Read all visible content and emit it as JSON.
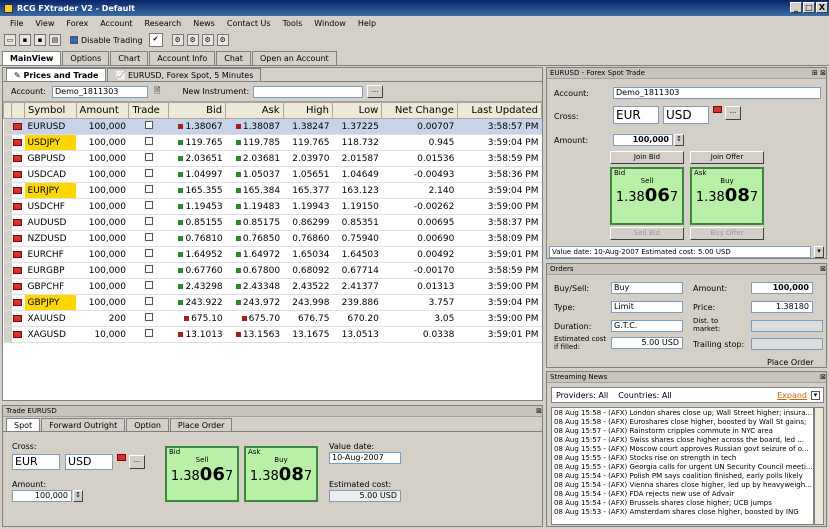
{
  "window": {
    "title": "RCG FXtrader V2 - Default",
    "min": "_",
    "max": "□",
    "close": "X"
  },
  "menu": [
    "File",
    "View",
    "Forex",
    "Account",
    "Research",
    "News",
    "Contact Us",
    "Tools",
    "Window",
    "Help"
  ],
  "toolbar": {
    "disable_trading": "Disable Trading"
  },
  "main_tabs": [
    "MainView",
    "Options",
    "Chart",
    "Account Info",
    "Chat",
    "Open an Account"
  ],
  "doc_tabs": [
    "Prices and Trade",
    "EURUSD, Forex Spot, 5 Minutes"
  ],
  "account_bar": {
    "account_label": "Account:",
    "account_value": "Demo_1811303",
    "new_instrument_label": "New Instrument:",
    "browse": "..."
  },
  "columns": [
    "Symbol",
    "Amount",
    "Trade",
    "Bid",
    "Ask",
    "High",
    "Low",
    "Net Change",
    "Last Updated"
  ],
  "rows": [
    {
      "symbol": "EURUSD",
      "amount": "100,000",
      "bid": "1.38067",
      "ask": "1.38087",
      "high": "1.38247",
      "low": "1.37225",
      "change": "0.00707",
      "updated": "3:58:57 PM",
      "hl": false,
      "dir": "dn"
    },
    {
      "symbol": "USDJPY",
      "amount": "100,000",
      "bid": "119.765",
      "ask": "119.785",
      "high": "119.765",
      "low": "118.732",
      "change": "0.945",
      "updated": "3:59:04 PM",
      "hl": true,
      "dir": "up"
    },
    {
      "symbol": "GBPUSD",
      "amount": "100,000",
      "bid": "2.03651",
      "ask": "2.03681",
      "high": "2.03970",
      "low": "2.01587",
      "change": "0.01536",
      "updated": "3:58:59 PM",
      "hl": false,
      "dir": "up"
    },
    {
      "symbol": "USDCAD",
      "amount": "100,000",
      "bid": "1.04997",
      "ask": "1.05037",
      "high": "1.05651",
      "low": "1.04649",
      "change": "-0.00493",
      "updated": "3:58:36 PM",
      "hl": false,
      "dir": "up"
    },
    {
      "symbol": "EURJPY",
      "amount": "100,000",
      "bid": "165.355",
      "ask": "165.384",
      "high": "165.377",
      "low": "163.123",
      "change": "2.140",
      "updated": "3:59:04 PM",
      "hl": true,
      "dir": "up"
    },
    {
      "symbol": "USDCHF",
      "amount": "100,000",
      "bid": "1.19453",
      "ask": "1.19483",
      "high": "1.19943",
      "low": "1.19150",
      "change": "-0.00262",
      "updated": "3:59:00 PM",
      "hl": false,
      "dir": "up"
    },
    {
      "symbol": "AUDUSD",
      "amount": "100,000",
      "bid": "0.85155",
      "ask": "0.85175",
      "high": "0.86299",
      "low": "0.85351",
      "change": "0.00695",
      "updated": "3:58:37 PM",
      "hl": false,
      "dir": "up"
    },
    {
      "symbol": "NZDUSD",
      "amount": "100,000",
      "bid": "0.76810",
      "ask": "0.76850",
      "high": "0.76860",
      "low": "0.75940",
      "change": "0.00690",
      "updated": "3:58:09 PM",
      "hl": false,
      "dir": "up"
    },
    {
      "symbol": "EURCHF",
      "amount": "100,000",
      "bid": "1.64952",
      "ask": "1.64972",
      "high": "1.65034",
      "low": "1.64503",
      "change": "0.00492",
      "updated": "3:59:01 PM",
      "hl": false,
      "dir": "up"
    },
    {
      "symbol": "EURGBP",
      "amount": "100,000",
      "bid": "0.67760",
      "ask": "0.67800",
      "high": "0.68092",
      "low": "0.67714",
      "change": "-0.00170",
      "updated": "3:58:59 PM",
      "hl": false,
      "dir": "up"
    },
    {
      "symbol": "GBPCHF",
      "amount": "100,000",
      "bid": "2.43298",
      "ask": "2.43348",
      "high": "2.43522",
      "low": "2.41377",
      "change": "0.01313",
      "updated": "3:59:00 PM",
      "hl": false,
      "dir": "up"
    },
    {
      "symbol": "GBPJPY",
      "amount": "100,000",
      "bid": "243.922",
      "ask": "243.972",
      "high": "243.998",
      "low": "239.886",
      "change": "3.757",
      "updated": "3:59:04 PM",
      "hl": true,
      "dir": "up"
    },
    {
      "symbol": "XAUUSD",
      "amount": "200",
      "bid": "675.10",
      "ask": "675.70",
      "high": "676.75",
      "low": "670.20",
      "change": "3.05",
      "updated": "3:59:00 PM",
      "hl": false,
      "dir": "dn"
    },
    {
      "symbol": "XAGUSD",
      "amount": "10,000",
      "bid": "13.1013",
      "ask": "13.1563",
      "high": "13.1675",
      "low": "13.0513",
      "change": "0.0338",
      "updated": "3:59:01 PM",
      "hl": false,
      "dir": "dn"
    }
  ],
  "trade_panel": {
    "title": "Trade EURUSD",
    "tabs": [
      "Spot",
      "Forward Outright",
      "Option",
      "Place Order"
    ],
    "cross_label": "Cross:",
    "ccy1": "EUR",
    "ccy2": "USD",
    "amount_label": "Amount:",
    "amount": "100,000",
    "bid_label": "Bid",
    "ask_label": "Ask",
    "sell": "Sell",
    "buy": "Buy",
    "bid_prefix": "1.38",
    "bid_big": "06",
    "bid_small": "7",
    "ask_prefix": "1.38",
    "ask_big": "08",
    "ask_small": "7",
    "value_date_label": "Value date:",
    "value_date": "10-Aug-2007",
    "est_cost_label": "Estimated cost:",
    "est_cost": "5.00 USD"
  },
  "spot_panel": {
    "title": "EURUSD - Forex Spot Trade",
    "account_label": "Account:",
    "account": "Demo_1811303",
    "cross_label": "Cross:",
    "ccy1": "EUR",
    "ccy2": "USD",
    "amount_label": "Amount:",
    "amount": "100,000",
    "join_bid": "Join Bid",
    "join_offer": "Join Offer",
    "bid_label": "Bid",
    "ask_label": "Ask",
    "sell": "Sell",
    "buy": "Buy",
    "bid_prefix": "1.38",
    "bid_big": "06",
    "bid_small": "7",
    "ask_prefix": "1.38",
    "ask_big": "08",
    "ask_small": "7",
    "sell_bid": "Sell Bid",
    "buy_offer": "Buy Offer",
    "footer": "Value date: 10-Aug-2007   Estimated cost: 5.00 USD"
  },
  "orders": {
    "title": "Orders",
    "buysell_label": "Buy/Sell:",
    "buysell": "Buy",
    "amount_label": "Amount:",
    "amount": "100,000",
    "type_label": "Type:",
    "type": "Limit",
    "price_label": "Price:",
    "price": "1.38180",
    "duration_label": "Duration:",
    "duration": "G.T.C.",
    "dist_label": "Dist. to market:",
    "est_label": "Estimated cost if filled:",
    "est": "5.00 USD",
    "trailing_label": "Trailing stop:",
    "place_order": "Place Order"
  },
  "news": {
    "title": "Streaming News",
    "providers": "Providers: All",
    "countries": "Countries: All",
    "expand": "Expand",
    "items": [
      "08 Aug 15:58 - (AFX) London shares close up; Wall Street higher; insura...",
      "08 Aug 15:58 - (AFX) Euroshares close higher, boosted by Wall St gains;",
      "08 Aug 15:57 - (AFX) Rainstorm cripples commute in NYC area",
      "08 Aug 15:57 - (AFX) Swiss shares close higher across the board, led ...",
      "08 Aug 15:55 - (AFX) Moscow court approves Russian govt seizure of o...",
      "08 Aug 15:55 - (AFX) Stocks rise on strength in tech",
      "08 Aug 15:55 - (AFX) Georgia calls for urgent UN Security Council meeti...",
      "08 Aug 15:54 - (AFX) Polish PM says coalition finished, early polls likely",
      "08 Aug 15:54 - (AFX) Vienna shares close higher, led up by heavyweigh...",
      "08 Aug 15:54 - (AFX) FDA rejects new use of Advair",
      "08 Aug 15:54 - (AFX) Brussels shares close higher; UCB jumps",
      "08 Aug 15:53 - (AFX) Amsterdam shares close higher, boosted by ING"
    ]
  }
}
